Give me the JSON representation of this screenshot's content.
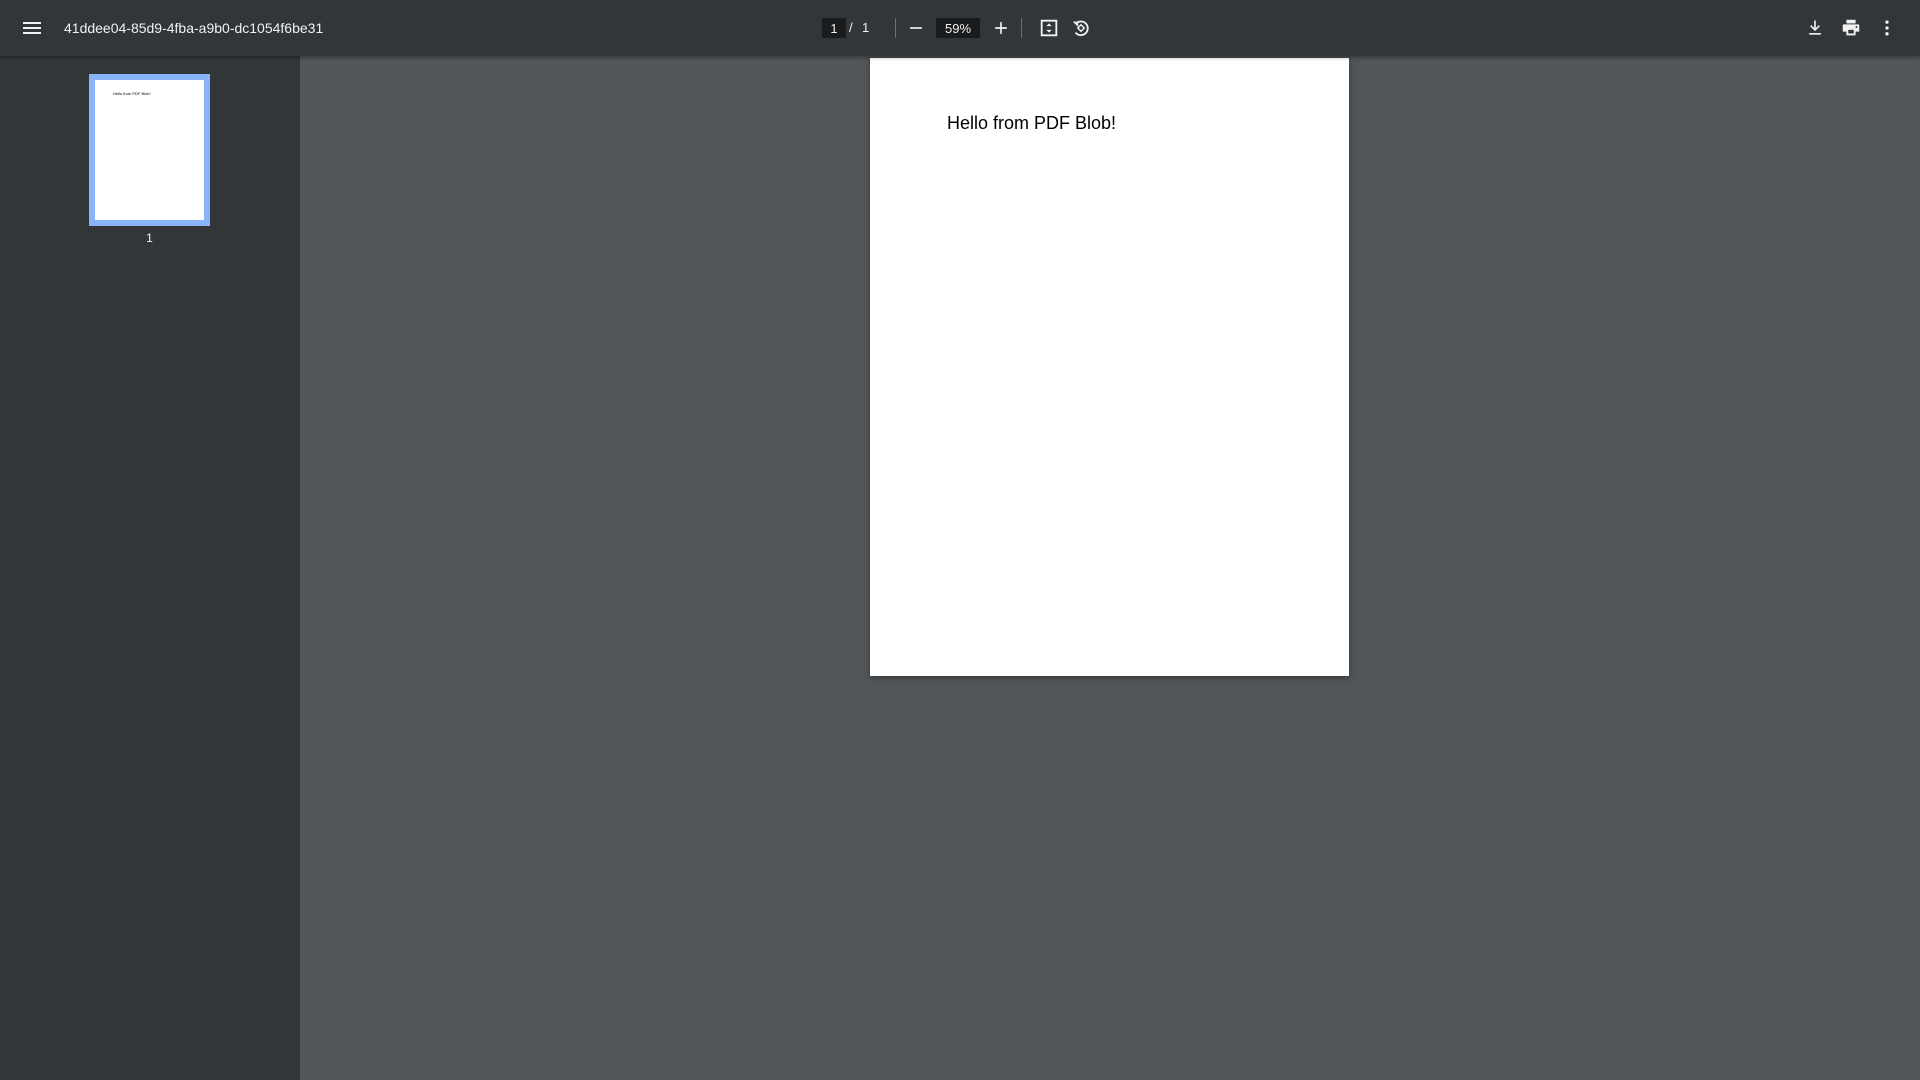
{
  "toolbar": {
    "title": "41ddee04-85d9-4fba-a9b0-dc1054f6be31",
    "page_current": "1",
    "page_separator": "/",
    "page_total": "1",
    "zoom": "59%",
    "icons": {
      "menu": "menu-icon",
      "zoom_out": "minus-icon",
      "zoom_in": "plus-icon",
      "fit": "fit-to-page-icon",
      "rotate": "rotate-counterclockwise-icon",
      "download": "download-icon",
      "print": "print-icon",
      "more": "more-vertical-icon"
    }
  },
  "sidebar": {
    "thumbnails": [
      {
        "label": "1",
        "preview_text": "Hello from PDF Blob!",
        "selected": true
      }
    ]
  },
  "document": {
    "pages": [
      {
        "text": "Hello from PDF Blob!"
      }
    ]
  },
  "colors": {
    "toolbar_bg": "#323639",
    "viewer_bg": "#525659",
    "thumbnail_selected": "#8ab4f8"
  }
}
